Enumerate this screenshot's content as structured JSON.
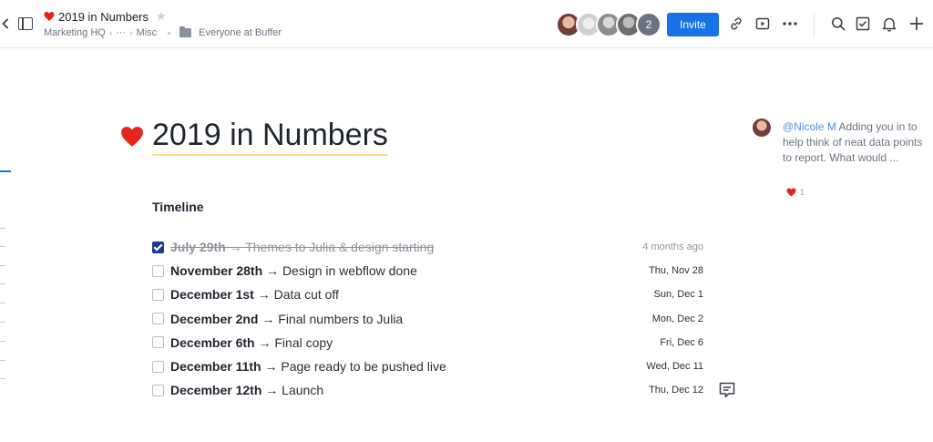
{
  "header": {
    "doc_title": "2019 in Numbers",
    "breadcrumb": {
      "root": "Marketing HQ",
      "sep1": "›",
      "ellipsis": "···",
      "sep2": "›",
      "folder": "Misc",
      "shared_with": "Everyone at Buffer"
    },
    "extra_members_count": "2",
    "invite_label": "Invite"
  },
  "icons": {
    "back": "chevron-left-icon",
    "sidebar": "sidebar-toggle-icon",
    "favorite": "star-icon",
    "link": "link-icon",
    "present": "play-icon",
    "more": "more-icon",
    "search": "search-icon",
    "tasks": "checkbox-icon",
    "notifications": "bell-icon",
    "new": "plus-icon",
    "comment": "comment-icon"
  },
  "colors": {
    "accent": "#1672e6",
    "checked": "#1a3f8f",
    "heart": "#e8231d",
    "title_underline": "#ffe08a",
    "mention": "#4a90e2"
  },
  "doc": {
    "title": "2019 in Numbers",
    "section": "Timeline",
    "arrow": "→",
    "items": [
      {
        "checked": true,
        "date_label": "July 29th",
        "task": "Themes to Julia & design starting",
        "due": "4 months ago"
      },
      {
        "checked": false,
        "date_label": "November 28th",
        "task": "Design in webflow done",
        "due": "Thu, Nov 28"
      },
      {
        "checked": false,
        "date_label": "December 1st",
        "task": "Data cut off",
        "due": "Sun, Dec 1"
      },
      {
        "checked": false,
        "date_label": "December 2nd",
        "task": "Final numbers to Julia",
        "due": "Mon, Dec 2"
      },
      {
        "checked": false,
        "date_label": "December 6th",
        "task": "Final copy",
        "due": "Fri, Dec 6"
      },
      {
        "checked": false,
        "date_label": "December 11th",
        "task": "Page ready to be pushed live",
        "due": "Wed, Dec 11"
      },
      {
        "checked": false,
        "date_label": "December 12th",
        "task": "Launch",
        "due": "Thu, Dec 12"
      }
    ]
  },
  "comment": {
    "mention": "@Nicole M",
    "text": "Adding you in to help think of neat data points to report. What would ...",
    "reaction_count": "1"
  }
}
